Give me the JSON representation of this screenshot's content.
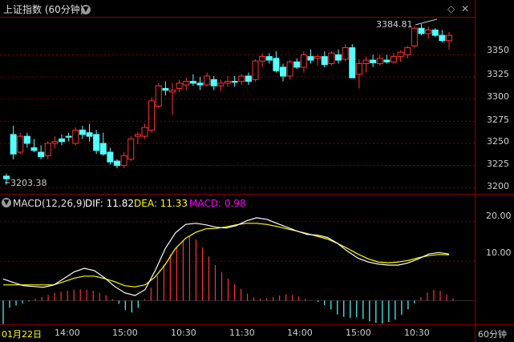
{
  "header": {
    "title": "上证指数 (60分钟)",
    "macd_label": "MACD(12,26,9)",
    "dif_label": "DIF: 11.82",
    "dea_label": "DEA: 11.33",
    "macd_value_label": "MACD: 0.98"
  },
  "price_axis_labels": [
    "3350",
    "3325",
    "3300",
    "3275",
    "3250",
    "3225",
    "3200"
  ],
  "macd_axis_labels": [
    "20.00",
    "10.00"
  ],
  "time_axis_labels": [
    "01月22日",
    "14:00",
    "15:00",
    "10:30",
    "11:30",
    "14:00",
    "15:00",
    "10:30"
  ],
  "period_label": "60分钟",
  "annotations": {
    "high": "3384.81",
    "low": "3203.38"
  },
  "colors": {
    "up": "#ff3232",
    "down": "#54ffff",
    "dif": "#ffffff",
    "dea": "#ffff00",
    "macd": "#ff00ff",
    "grid": "#8b0000"
  },
  "chart_data": [
    {
      "type": "candlestick",
      "ylim": [
        3193,
        3392
      ],
      "ohlc": [
        [
          3213,
          3216,
          3203.38,
          3210
        ],
        [
          3260,
          3270,
          3232,
          3238
        ],
        [
          3240,
          3262,
          3238,
          3258
        ],
        [
          3258,
          3262,
          3245,
          3250
        ],
        [
          3245,
          3255,
          3240,
          3242
        ],
        [
          3240,
          3248,
          3232,
          3235
        ],
        [
          3236,
          3252,
          3232,
          3250
        ],
        [
          3250,
          3258,
          3244,
          3252
        ],
        [
          3255,
          3260,
          3248,
          3252
        ],
        [
          3258,
          3262,
          3252,
          3257
        ],
        [
          3250,
          3268,
          3248,
          3265
        ],
        [
          3265,
          3270,
          3255,
          3260
        ],
        [
          3262,
          3272,
          3252,
          3258
        ],
        [
          3260,
          3265,
          3238,
          3242
        ],
        [
          3250,
          3262,
          3236,
          3238
        ],
        [
          3240,
          3245,
          3226,
          3229
        ],
        [
          3230,
          3232,
          3222,
          3225
        ],
        [
          3225,
          3240,
          3222,
          3236
        ],
        [
          3232,
          3258,
          3230,
          3255
        ],
        [
          3258,
          3263,
          3249,
          3260
        ],
        [
          3258,
          3272,
          3255,
          3268
        ],
        [
          3265,
          3302,
          3262,
          3298
        ],
        [
          3292,
          3318,
          3290,
          3315
        ],
        [
          3312,
          3320,
          3304,
          3310
        ],
        [
          3308,
          3318,
          3282,
          3310
        ],
        [
          3312,
          3322,
          3308,
          3318
        ],
        [
          3316,
          3324,
          3310,
          3320
        ],
        [
          3320,
          3328,
          3315,
          3318
        ],
        [
          3318,
          3325,
          3310,
          3316
        ],
        [
          3316,
          3330,
          3314,
          3326
        ],
        [
          3322,
          3326,
          3310,
          3315
        ],
        [
          3315,
          3322,
          3309,
          3318
        ],
        [
          3318,
          3326,
          3314,
          3320
        ],
        [
          3320,
          3326,
          3314,
          3319
        ],
        [
          3320,
          3328,
          3316,
          3326
        ],
        [
          3326,
          3330,
          3316,
          3320
        ],
        [
          3322,
          3345,
          3320,
          3343
        ],
        [
          3343,
          3352,
          3336,
          3348
        ],
        [
          3348,
          3352,
          3340,
          3344
        ],
        [
          3346,
          3354,
          3330,
          3332
        ],
        [
          3336,
          3340,
          3320,
          3326
        ],
        [
          3326,
          3344,
          3322,
          3342
        ],
        [
          3342,
          3346,
          3334,
          3336
        ],
        [
          3336,
          3354,
          3330,
          3350
        ],
        [
          3348,
          3356,
          3340,
          3344
        ],
        [
          3346,
          3350,
          3338,
          3348
        ],
        [
          3348,
          3354,
          3336,
          3339
        ],
        [
          3340,
          3354,
          3338,
          3352
        ],
        [
          3350,
          3356,
          3340,
          3344
        ],
        [
          3345,
          3362,
          3343,
          3358
        ],
        [
          3358,
          3362,
          3340,
          3324
        ],
        [
          3328,
          3345,
          3312,
          3340
        ],
        [
          3340,
          3348,
          3330,
          3344
        ],
        [
          3344,
          3350,
          3336,
          3341
        ],
        [
          3340,
          3350,
          3338,
          3346
        ],
        [
          3344,
          3350,
          3340,
          3342
        ],
        [
          3342,
          3352,
          3340,
          3348
        ],
        [
          3348,
          3355,
          3342,
          3353
        ],
        [
          3350,
          3360,
          3346,
          3358
        ],
        [
          3360,
          3382,
          3358,
          3380
        ],
        [
          3380,
          3384.81,
          3372,
          3374
        ],
        [
          3374,
          3382,
          3368,
          3378
        ],
        [
          3378,
          3380,
          3370,
          3372
        ],
        [
          3372,
          3378,
          3364,
          3366
        ],
        [
          3366,
          3376,
          3356,
          3372
        ]
      ]
    },
    {
      "type": "macd",
      "ylim": [
        -6,
        23
      ],
      "dif": [
        5.5,
        4.6,
        3.8,
        3.6,
        3.4,
        4,
        5.6,
        7.3,
        8.2,
        7.6,
        5.8,
        3.6,
        2,
        1.3,
        2.8,
        7.6,
        13.2,
        17.2,
        19.3,
        19.6,
        19.2,
        18.6,
        18.4,
        19,
        20.2,
        21,
        20.6,
        19.6,
        18.6,
        17.6,
        16.8,
        16.6,
        16,
        14.5,
        12.5,
        10.8,
        9.8,
        9.3,
        9,
        9,
        9.6,
        10.6,
        11.8,
        12.2,
        11.8
      ],
      "dea": [
        4,
        4,
        4,
        4,
        4,
        4,
        4.8,
        5.7,
        6.2,
        6.2,
        5.6,
        4.8,
        3.8,
        3.5,
        4,
        6,
        9.2,
        13.2,
        15.8,
        17.3,
        18.2,
        18.3,
        18.7,
        19.2,
        19.6,
        19.6,
        19.3,
        18.8,
        18.2,
        17.6,
        17,
        16.3,
        15.6,
        14.5,
        13.2,
        11.8,
        10.6,
        9.8,
        9.6,
        9.8,
        10.2,
        10.9,
        11.4,
        11.7,
        11.6
      ],
      "histogram": [
        -5.9,
        -1.8,
        -1.2,
        -0.7,
        -0.2,
        0.5,
        1,
        1.5,
        2,
        2.3,
        2.6,
        2.8,
        2.9,
        2.8,
        2.5,
        2,
        1.4,
        0.4,
        -0.8,
        -2.4,
        -3,
        -1.8,
        0.4,
        3.3,
        6.3,
        9.2,
        11.7,
        13.6,
        15.3,
        16.3,
        15.5,
        13.5,
        11.2,
        9,
        7.2,
        5.6,
        4.2,
        3,
        1.8,
        0.8,
        0.5,
        0.6,
        0.9,
        1.3,
        1.6,
        1.4,
        1.1,
        0.5,
        0.1,
        -0.3,
        -1.1,
        -2.2,
        -3.5,
        -4.1,
        -4.4,
        -4.2,
        -4.6,
        -5.2,
        -5.6,
        -5.8,
        -5.4,
        -4.8,
        -3.6,
        -2.2,
        -0.7,
        0.9,
        2.1,
        2.7,
        2.5,
        1.6,
        0.6
      ]
    }
  ]
}
